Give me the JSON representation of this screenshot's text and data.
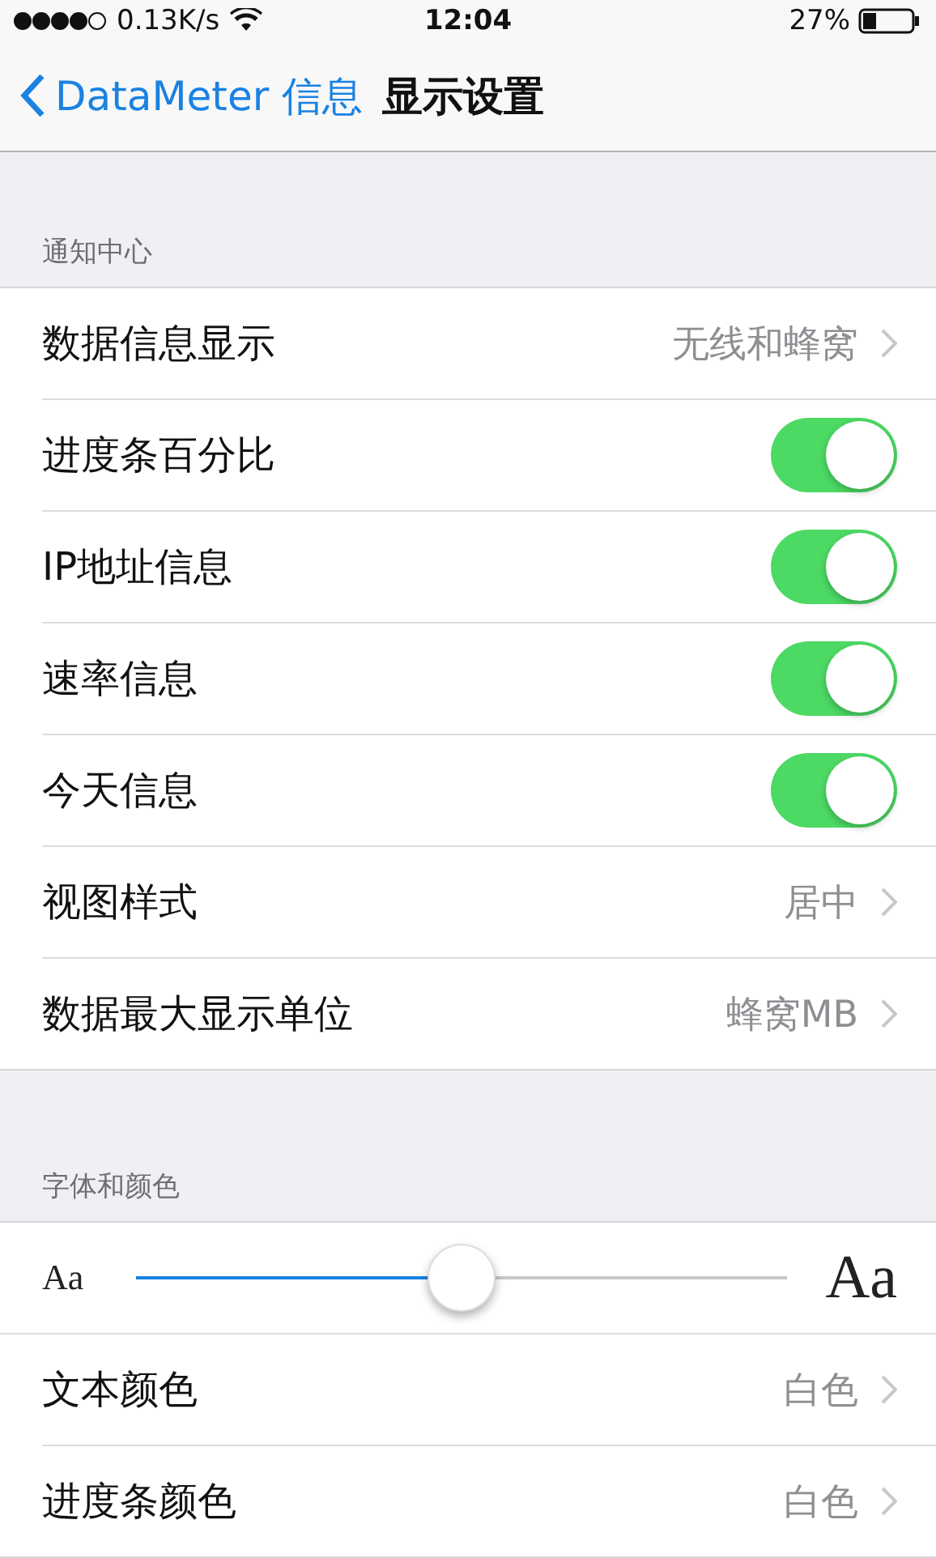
{
  "status_bar": {
    "speed": "0.13K/s",
    "time": "12:04",
    "battery": "27%"
  },
  "nav": {
    "back": "DataMeter 信息",
    "title": "显示设置"
  },
  "sections": [
    {
      "header": "通知中心",
      "rows": [
        {
          "kind": "detail",
          "label": "数据信息显示",
          "value": "无线和蜂窝"
        },
        {
          "kind": "toggle",
          "label": "进度条百分比",
          "on": true
        },
        {
          "kind": "toggle",
          "label": "IP地址信息",
          "on": true
        },
        {
          "kind": "toggle",
          "label": "速率信息",
          "on": true
        },
        {
          "kind": "toggle",
          "label": "今天信息",
          "on": true
        },
        {
          "kind": "detail",
          "label": "视图样式",
          "value": "居中"
        },
        {
          "kind": "detail",
          "label": "数据最大显示单位",
          "value": "蜂窝MB"
        }
      ]
    },
    {
      "header": "字体和颜色",
      "rows": [
        {
          "kind": "slider",
          "min_label": "Aa",
          "max_label": "Aa",
          "level": 0.5
        },
        {
          "kind": "detail",
          "label": "文本颜色",
          "value": "白色"
        },
        {
          "kind": "detail",
          "label": "进度条颜色",
          "value": "白色"
        }
      ]
    }
  ]
}
